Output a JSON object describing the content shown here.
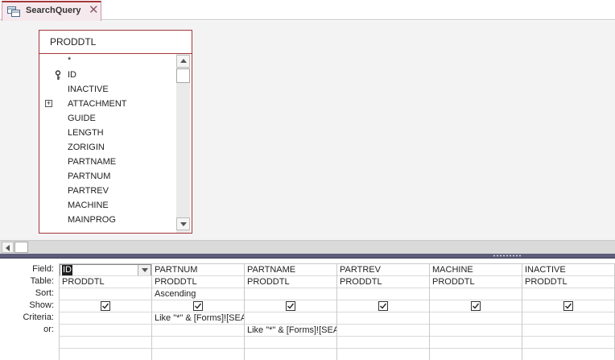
{
  "tab": {
    "label": "SearchQuery",
    "close_glyph": "✕"
  },
  "table": {
    "name": "PRODDTL",
    "fields": [
      {
        "label": "*",
        "icon": null
      },
      {
        "label": "ID",
        "icon": "primary-key-icon"
      },
      {
        "label": "INACTIVE",
        "icon": null
      },
      {
        "label": "ATTACHMENT",
        "icon": "expand-icon"
      },
      {
        "label": "GUIDE",
        "icon": null
      },
      {
        "label": "LENGTH",
        "icon": null
      },
      {
        "label": "ZORIGIN",
        "icon": null
      },
      {
        "label": "PARTNAME",
        "icon": null
      },
      {
        "label": "PARTNUM",
        "icon": null
      },
      {
        "label": "PARTREV",
        "icon": null
      },
      {
        "label": "MACHINE",
        "icon": null
      },
      {
        "label": "MAINPROG",
        "icon": null
      }
    ]
  },
  "grid": {
    "row_labels": [
      "Field:",
      "Table:",
      "Sort:",
      "Show:",
      "Criteria:",
      "or:"
    ],
    "columns": [
      {
        "field": "ID",
        "table": "PRODDTL",
        "sort": "",
        "show": true,
        "criteria": "",
        "or": "",
        "selected": true
      },
      {
        "field": "PARTNUM",
        "table": "PRODDTL",
        "sort": "Ascending",
        "show": true,
        "criteria": "Like \"*\" & [Forms]![SEA",
        "or": ""
      },
      {
        "field": "PARTNAME",
        "table": "PRODDTL",
        "sort": "",
        "show": true,
        "criteria": "",
        "or": "Like \"*\" & [Forms]![SEA"
      },
      {
        "field": "PARTREV",
        "table": "PRODDTL",
        "sort": "",
        "show": true,
        "criteria": "",
        "or": ""
      },
      {
        "field": "MACHINE",
        "table": "PRODDTL",
        "sort": "",
        "show": true,
        "criteria": "",
        "or": ""
      },
      {
        "field": "INACTIVE",
        "table": "PRODDTL",
        "sort": "",
        "show": true,
        "criteria": "",
        "or": ""
      }
    ]
  },
  "colors": {
    "accent": "#a4373a",
    "splitter": "#5e5e7a",
    "pane_bg": "#f3f3f3"
  }
}
